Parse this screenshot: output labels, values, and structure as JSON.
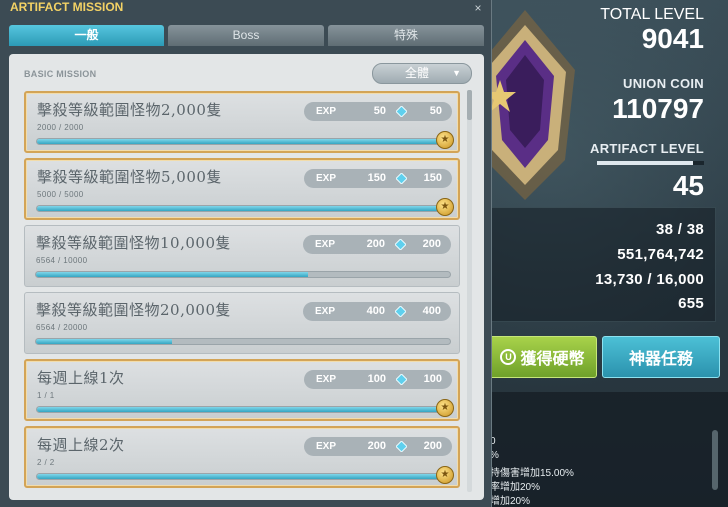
{
  "window": {
    "title": "ARTIFACT MISSION",
    "close_label": "×",
    "tabs": [
      {
        "label": "一般",
        "active": true
      },
      {
        "label": "Boss",
        "active": false
      },
      {
        "label": "特殊",
        "active": false
      }
    ],
    "section_title": "BASIC MISSION",
    "filter": {
      "selected": "全體"
    },
    "exp_label": "EXP",
    "missions": [
      {
        "title": "擊殺等級範圍怪物2,000隻",
        "progress_text": "2000 / 2000",
        "progress": 1.0,
        "exp": "50",
        "coin": "50",
        "completed": true
      },
      {
        "title": "擊殺等級範圍怪物5,000隻",
        "progress_text": "5000 / 5000",
        "progress": 1.0,
        "exp": "150",
        "coin": "150",
        "completed": true
      },
      {
        "title": "擊殺等級範圍怪物10,000隻",
        "progress_text": "6564 / 10000",
        "progress": 0.6564,
        "exp": "200",
        "coin": "200",
        "completed": false
      },
      {
        "title": "擊殺等級範圍怪物20,000隻",
        "progress_text": "6564 / 20000",
        "progress": 0.3282,
        "exp": "400",
        "coin": "400",
        "completed": false
      },
      {
        "title": "每週上線1次",
        "progress_text": "1 / 1",
        "progress": 1.0,
        "exp": "100",
        "coin": "100",
        "completed": true
      },
      {
        "title": "每週上線2次",
        "progress_text": "2 / 2",
        "progress": 1.0,
        "exp": "200",
        "coin": "200",
        "completed": true
      }
    ]
  },
  "stats": {
    "total_level_label": "TOTAL LEVEL",
    "total_level": "9041",
    "union_coin_label": "UNION COIN",
    "union_coin": "110797",
    "artifact_level_label": "ARTIFACT LEVEL",
    "artifact_level": "45",
    "artifact_level_progress": 0.9,
    "details": [
      "38 / 38",
      "551,764,742",
      "13,730 / 16,000",
      "655"
    ]
  },
  "buttons": {
    "get_coin": "獲得硬幣",
    "coin_icon": "U",
    "artifact_mission": "神器任務"
  },
  "effects": [
    "0",
    "%",
    "持傷害增加15.00%",
    "率增加20%",
    "增加20%"
  ],
  "colors": {
    "accent_blue": "#2c9ab6",
    "accent_green": "#6fa12a",
    "title_gold": "#f3d265",
    "completed_border": "#d3a457"
  },
  "icons": {
    "reward_coin": "diamond-icon",
    "completed": "medal-icon",
    "close": "close-icon",
    "filter": "chevron-down-icon"
  }
}
